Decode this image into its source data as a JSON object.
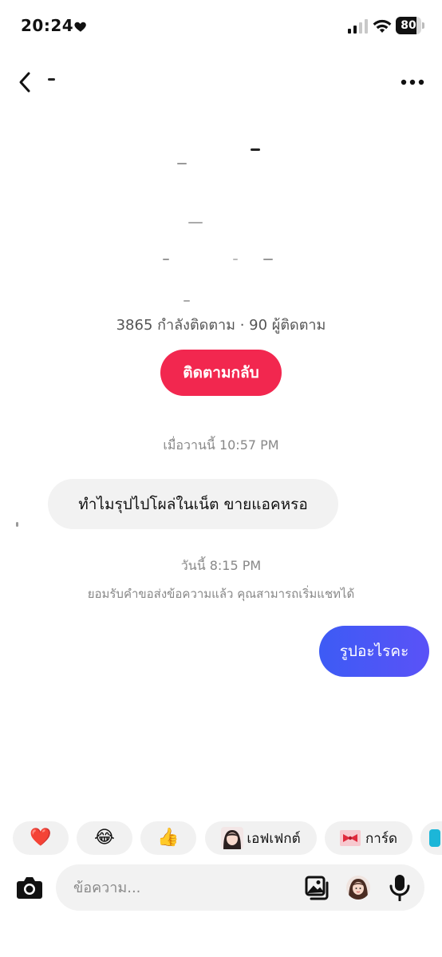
{
  "status_bar": {
    "time": "20:24",
    "battery_level": "80",
    "battery_fraction": 0.8
  },
  "profile": {
    "stats": "3865 กำลังติดตาม · 90 ผู้ติดตาม",
    "follow_back_label": "ติดตามกลับ"
  },
  "conversation": {
    "timestamp_1": "เมื่อวานนี้ 10:57 PM",
    "incoming_message": "ทำไมรุปไปโผล่ในเน็ต ขายแอคหรอ",
    "timestamp_2": "วันนี้ 8:15 PM",
    "system_note": "ยอมรับคำขอส่งข้อความแล้ว คุณสามารถเริ่มแชทได้",
    "outgoing_message": "รูปอะไรคะ"
  },
  "quick_reactions": {
    "heart": "❤️",
    "laugh": "😂",
    "thumbs_up": "👍",
    "effect_label": "เอฟเฟกต์",
    "card_label": "การ์ด"
  },
  "composer": {
    "placeholder": "ข้อความ..."
  },
  "colors": {
    "accent_red": "#f2274f",
    "bubble_out": "#4a57f6",
    "bubble_in": "#f2f2f2"
  },
  "icons": [
    "heart-icon",
    "signal-icon",
    "wifi-icon",
    "battery-icon",
    "back-arrow-icon",
    "more-icon",
    "camera-icon",
    "gallery-icon",
    "avatar-icon",
    "microphone-icon"
  ]
}
